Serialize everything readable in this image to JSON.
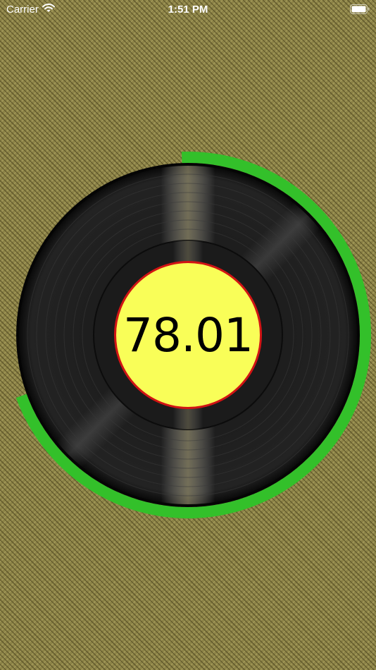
{
  "status_bar": {
    "carrier": "Carrier",
    "time": "1:51 PM",
    "wifi_icon": "wifi-icon",
    "battery_icon": "battery-icon"
  },
  "record": {
    "speed_value": "78.01",
    "progress_color": "#33c02a",
    "label_color": "#f9fe58",
    "label_border_color": "#d11414"
  }
}
